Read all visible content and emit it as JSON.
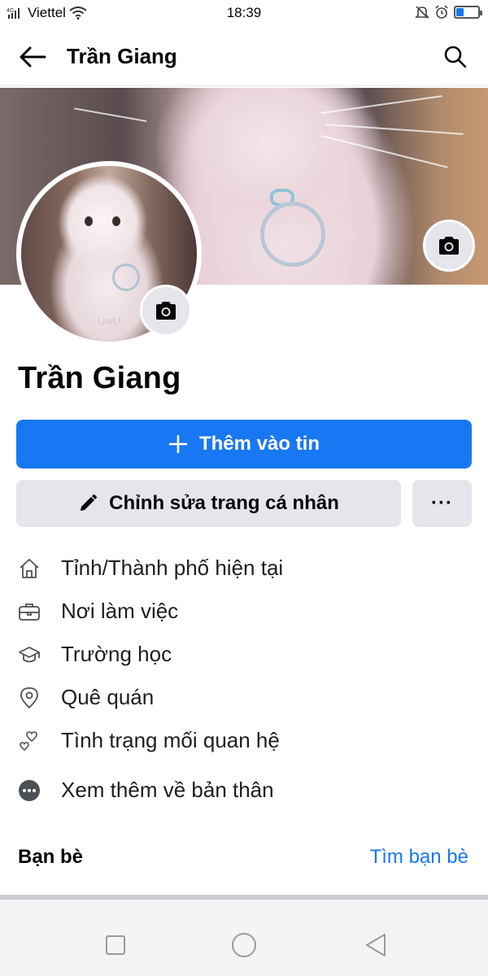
{
  "status_bar": {
    "carrier": "Viettel",
    "time": "18:39"
  },
  "header": {
    "title": "Trần Giang"
  },
  "profile": {
    "name": "Trần Giang",
    "avatar_caption": "UwU"
  },
  "actions": {
    "add_story_label": "Thêm vào tin",
    "edit_profile_label": "Chỉnh sửa trang cá nhân",
    "more_label": "···"
  },
  "details": [
    {
      "icon": "home-icon",
      "label": "Tỉnh/Thành phố hiện tại"
    },
    {
      "icon": "briefcase-icon",
      "label": "Nơi làm việc"
    },
    {
      "icon": "graduation-cap-icon",
      "label": "Trường học"
    },
    {
      "icon": "location-pin-icon",
      "label": "Quê quán"
    },
    {
      "icon": "hearts-icon",
      "label": "Tình trạng mối quan hệ"
    },
    {
      "icon": "more-dots-icon",
      "label": "Xem thêm về bản thân"
    }
  ],
  "friends": {
    "title": "Bạn bè",
    "find_link": "Tìm bạn bè"
  },
  "colors": {
    "accent": "#1877f2",
    "button_gray": "#e4e6eb",
    "text": "#050505"
  }
}
